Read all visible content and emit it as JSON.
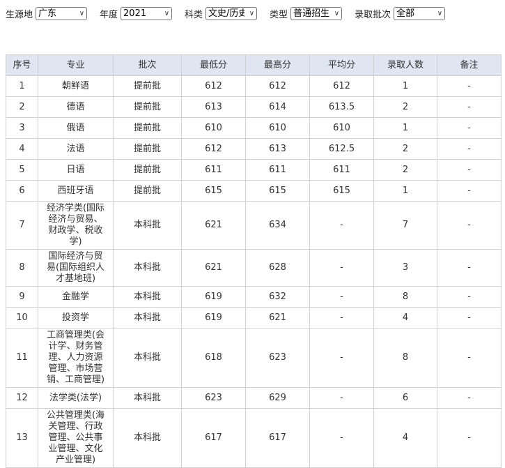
{
  "filters": [
    {
      "label": "生源地",
      "value": "广东"
    },
    {
      "label": "年度",
      "value": "2021"
    },
    {
      "label": "科类",
      "value": "文史/历史"
    },
    {
      "label": "类型",
      "value": "普通招生"
    },
    {
      "label": "录取批次",
      "value": "全部"
    }
  ],
  "table": {
    "headers": [
      "序号",
      "专业",
      "批次",
      "最低分",
      "最高分",
      "平均分",
      "录取人数",
      "备注"
    ],
    "rows": [
      [
        "1",
        "朝鲜语",
        "提前批",
        "612",
        "612",
        "612",
        "1",
        "-"
      ],
      [
        "2",
        "德语",
        "提前批",
        "613",
        "614",
        "613.5",
        "2",
        "-"
      ],
      [
        "3",
        "俄语",
        "提前批",
        "610",
        "610",
        "610",
        "1",
        "-"
      ],
      [
        "4",
        "法语",
        "提前批",
        "612",
        "613",
        "612.5",
        "2",
        "-"
      ],
      [
        "5",
        "日语",
        "提前批",
        "611",
        "611",
        "611",
        "2",
        "-"
      ],
      [
        "6",
        "西班牙语",
        "提前批",
        "615",
        "615",
        "615",
        "1",
        "-"
      ],
      [
        "7",
        "经济学类(国际经济与贸易、财政学、税收学)",
        "本科批",
        "621",
        "634",
        "-",
        "7",
        "-"
      ],
      [
        "8",
        "国际经济与贸易(国际组织人才基地班)",
        "本科批",
        "621",
        "628",
        "-",
        "3",
        "-"
      ],
      [
        "9",
        "金融学",
        "本科批",
        "619",
        "632",
        "-",
        "8",
        "-"
      ],
      [
        "10",
        "投资学",
        "本科批",
        "619",
        "621",
        "-",
        "4",
        "-"
      ],
      [
        "11",
        "工商管理类(会计学、财务管理、人力资源管理、市场营销、工商管理)",
        "本科批",
        "618",
        "623",
        "-",
        "8",
        "-"
      ],
      [
        "12",
        "法学类(法学)",
        "本科批",
        "623",
        "629",
        "-",
        "6",
        "-"
      ],
      [
        "13",
        "公共管理类(海关管理、行政管理、公共事业管理、文化产业管理)",
        "本科批",
        "617",
        "617",
        "-",
        "4",
        "-"
      ]
    ]
  }
}
